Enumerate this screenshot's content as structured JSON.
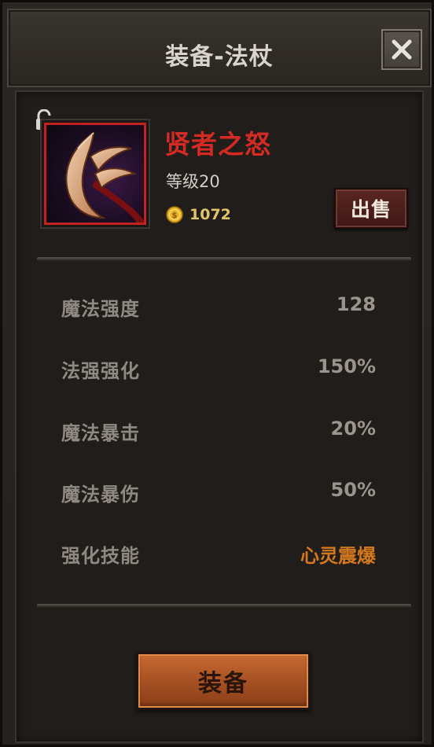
{
  "dialog": {
    "title": "装备-法杖",
    "close_icon": "close-icon"
  },
  "item": {
    "name": "贤者之怒",
    "level": "等级20",
    "price": "1072",
    "lock_icon": "lock-icon",
    "coin_icon": "coin-icon",
    "rarity_color": "#c32121",
    "name_color": "#d42a24"
  },
  "actions": {
    "sell_label": "出售",
    "equip_label": "装备"
  },
  "stats": [
    {
      "label": "魔法强度",
      "value": "128"
    },
    {
      "label": "法强强化",
      "value": "150%"
    },
    {
      "label": "魔法暴击",
      "value": "20%"
    },
    {
      "label": "魔法暴伤",
      "value": "50%"
    },
    {
      "label": "强化技能",
      "value": "心灵震爆"
    }
  ],
  "colors": {
    "skill_value": "#d4781e",
    "price": "#e0c36a",
    "equip_button": "#b35a28"
  }
}
